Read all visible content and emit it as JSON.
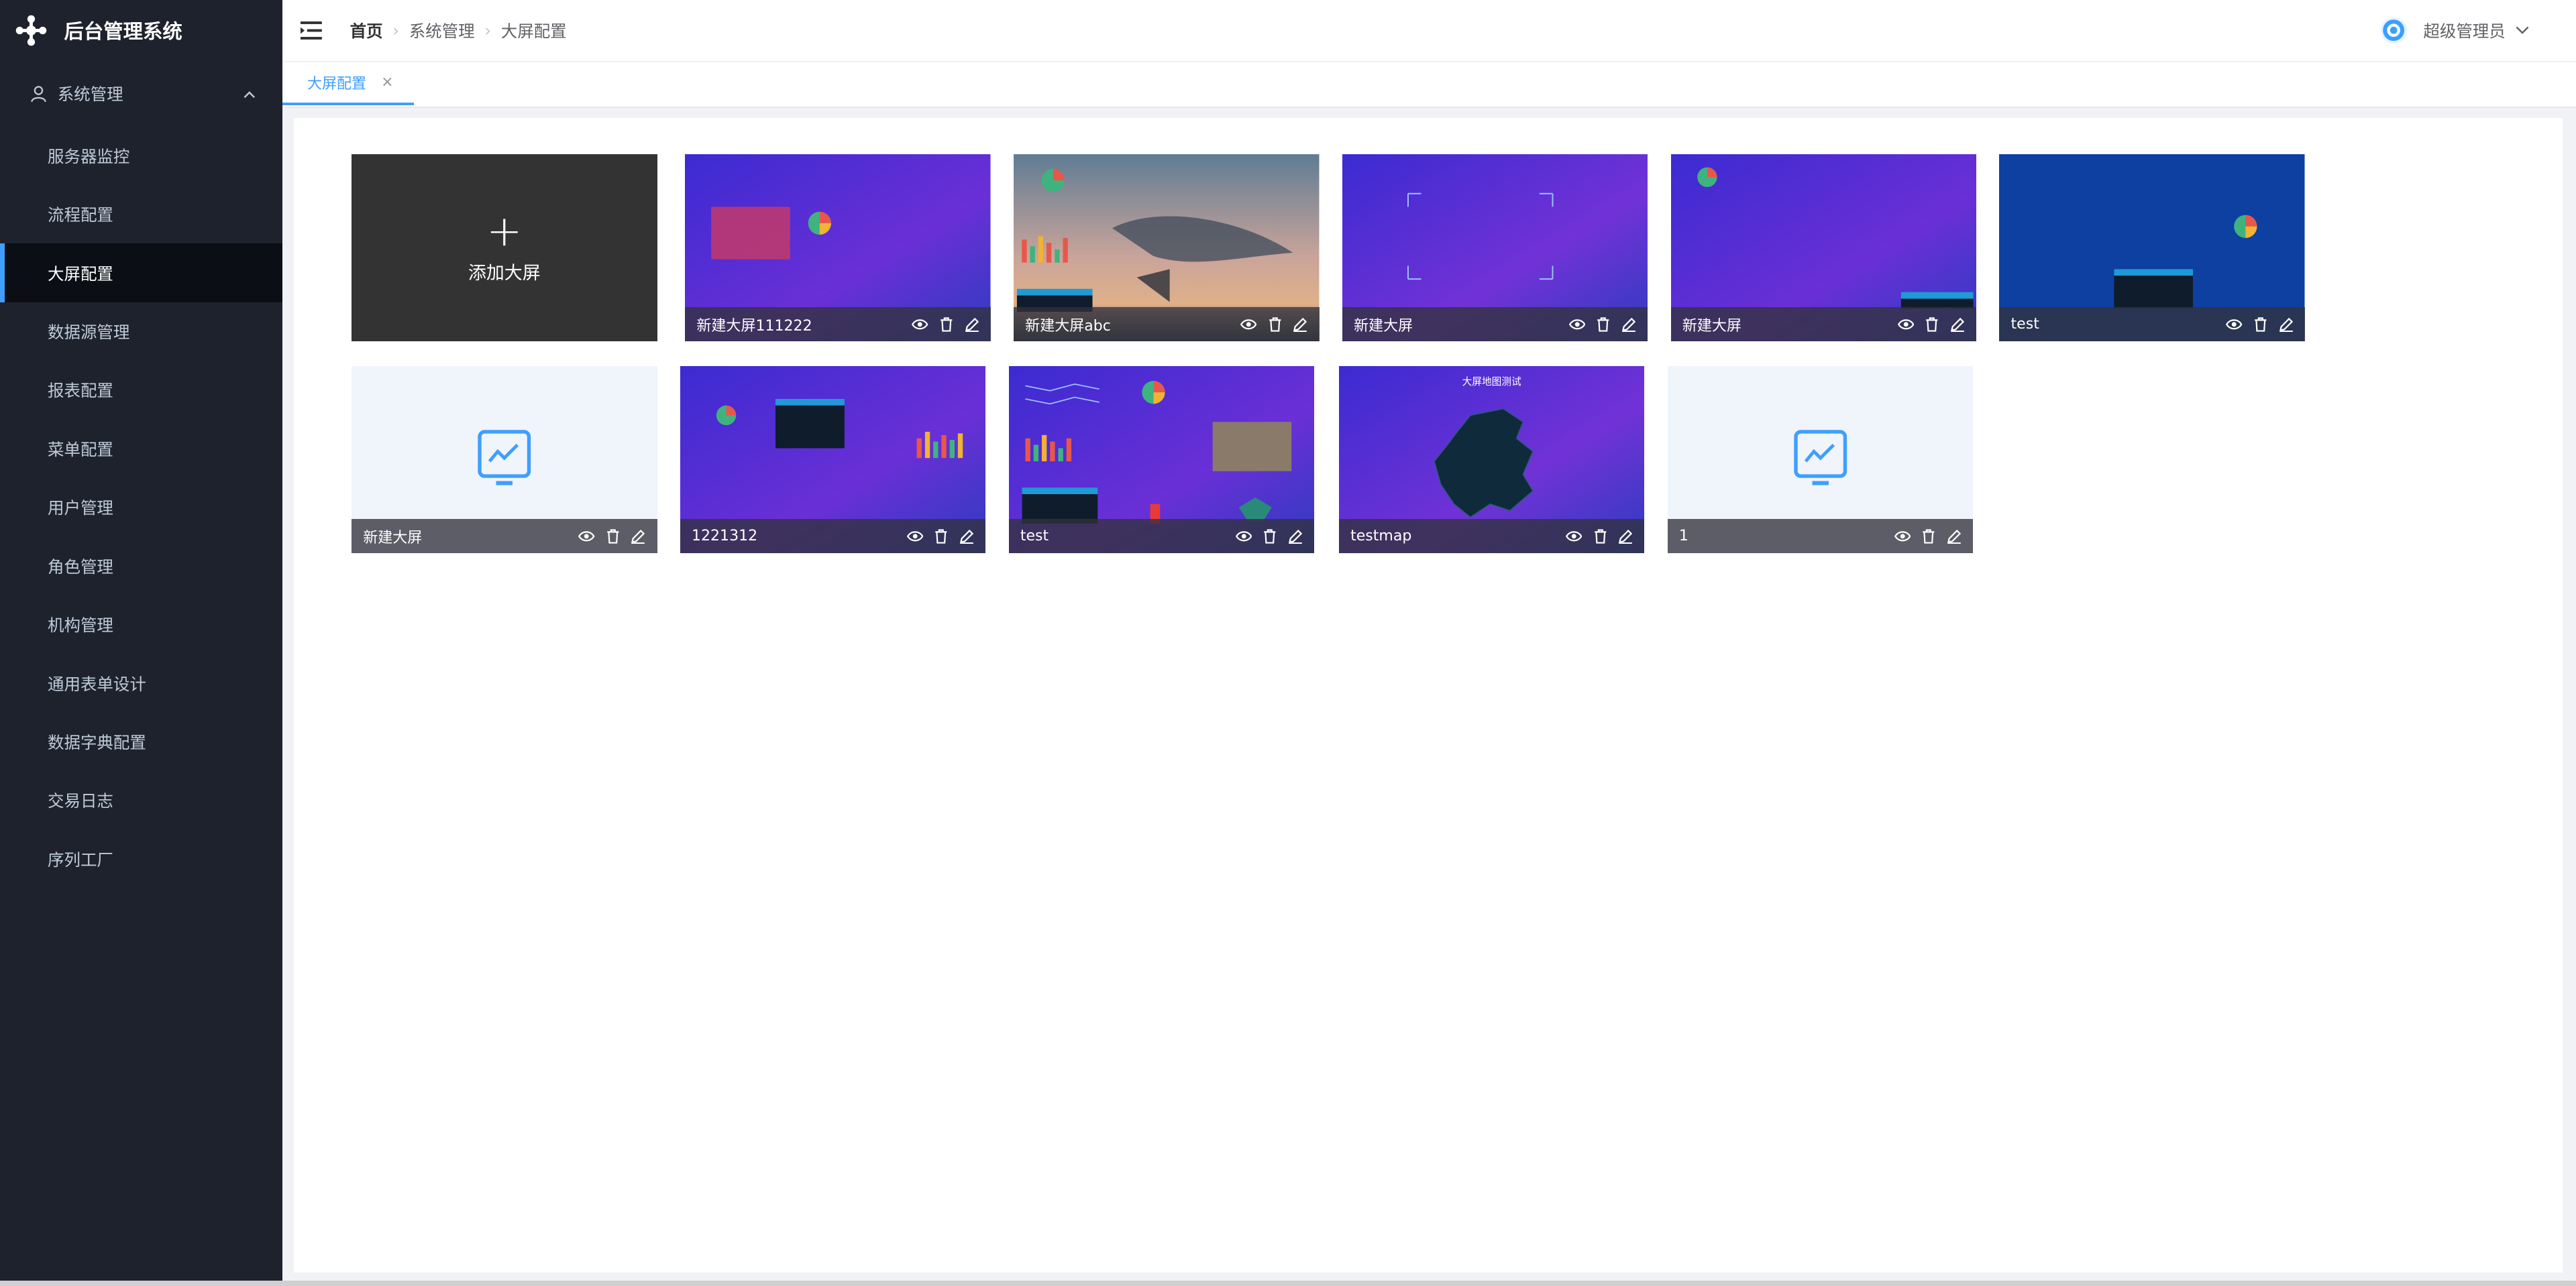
{
  "app": {
    "title": "后台管理系统"
  },
  "sidebar": {
    "group": "系统管理",
    "items": [
      {
        "label": "服务器监控"
      },
      {
        "label": "流程配置"
      },
      {
        "label": "大屏配置",
        "active": true
      },
      {
        "label": "数据源管理"
      },
      {
        "label": "报表配置"
      },
      {
        "label": "菜单配置"
      },
      {
        "label": "用户管理"
      },
      {
        "label": "角色管理"
      },
      {
        "label": "机构管理"
      },
      {
        "label": "通用表单设计"
      },
      {
        "label": "数据字典配置"
      },
      {
        "label": "交易日志"
      },
      {
        "label": "序列工厂"
      }
    ]
  },
  "header": {
    "breadcrumb": [
      "首页",
      "系统管理",
      "大屏配置"
    ],
    "user": "超级管理员"
  },
  "tabs": [
    {
      "label": "大屏配置",
      "close": "×"
    }
  ],
  "grid": {
    "add_label": "添加大屏",
    "add_symbol": "+",
    "cards": [
      {
        "title": "新建大屏111222",
        "thumb": "purple-chart"
      },
      {
        "title": "新建大屏abc",
        "thumb": "photo-whale"
      },
      {
        "title": "新建大屏",
        "thumb": "purple-frames"
      },
      {
        "title": "新建大屏",
        "thumb": "purple-pie-table"
      },
      {
        "title": "test",
        "thumb": "blue-table"
      },
      {
        "title": "新建大屏",
        "thumb": "empty-monitor"
      },
      {
        "title": "1221312",
        "thumb": "purple-table-bars"
      },
      {
        "title": "test",
        "thumb": "purple-dashboard"
      },
      {
        "title": "testmap",
        "thumb": "purple-map",
        "overlay_title": "大屏地图测试"
      },
      {
        "title": "1",
        "thumb": "empty-monitor"
      }
    ]
  },
  "icons": {
    "view": "eye-icon",
    "delete": "trash-icon",
    "edit": "edit-icon"
  },
  "colors": {
    "accent": "#409eff",
    "sidebar_bg": "#1e222d",
    "purple_a": "#5b2bd6",
    "purple_b": "#2f3ab8"
  }
}
